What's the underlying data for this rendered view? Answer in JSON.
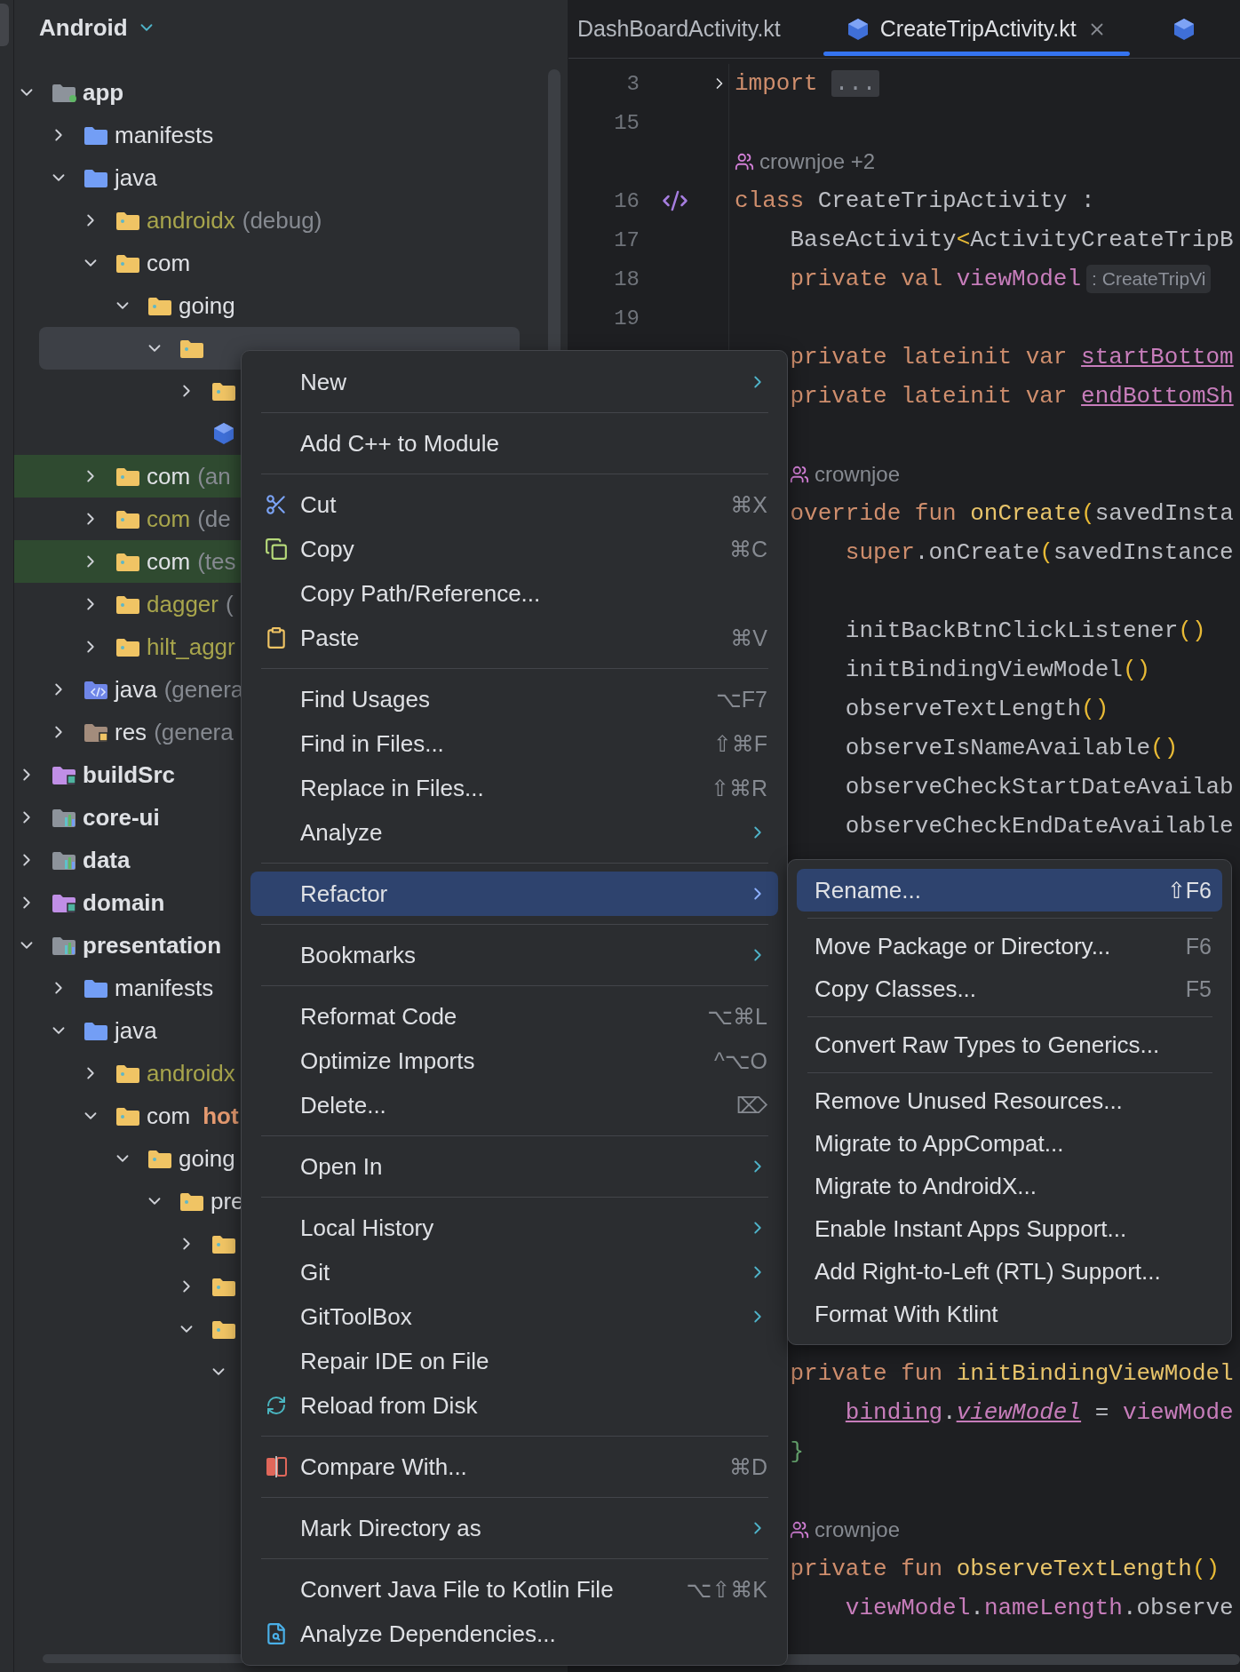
{
  "project": {
    "view": "Android",
    "tree": [
      {
        "label": "app",
        "kind": "module-app",
        "expanded": true,
        "selected": false,
        "highlighted": false,
        "children": [
          {
            "label": "manifests",
            "kind": "source-root",
            "expanded": false,
            "selected": false,
            "highlighted": false
          },
          {
            "label": "java",
            "kind": "source-root",
            "expanded": true,
            "selected": false,
            "highlighted": false,
            "children": [
              {
                "label": "androidx",
                "note": "(debug)",
                "color": "#a8a54c",
                "kind": "package",
                "expanded": false,
                "selected": false,
                "highlighted": false
              },
              {
                "label": "com",
                "kind": "package",
                "expanded": true,
                "selected": false,
                "highlighted": false,
                "children": [
                  {
                    "label": "going",
                    "kind": "package",
                    "expanded": true,
                    "selected": false,
                    "highlighted": false,
                    "children": [
                      {
                        "kind": "package",
                        "expanded": true,
                        "selected": true,
                        "highlighted": false,
                        "children": [
                          {
                            "kind": "package",
                            "expanded": false,
                            "selected": false,
                            "highlighted": false
                          },
                          {
                            "kind": "kotlin",
                            "selected": false,
                            "highlighted": false
                          }
                        ]
                      }
                    ]
                  }
                ]
              },
              {
                "label": "com",
                "note": "(an",
                "kind": "package",
                "expanded": false,
                "selected": false,
                "highlighted": true
              },
              {
                "label": "com",
                "note": "(de",
                "color": "#a8a54c",
                "kind": "package",
                "expanded": false,
                "selected": false,
                "highlighted": false
              },
              {
                "label": "com",
                "note": "(tes",
                "kind": "package",
                "expanded": false,
                "selected": false,
                "highlighted": true
              },
              {
                "label": "dagger",
                "note": "(",
                "color": "#a8a54c",
                "kind": "package",
                "expanded": false,
                "selected": false,
                "highlighted": false
              },
              {
                "label": "hilt_aggr",
                "color": "#a8a54c",
                "kind": "package",
                "expanded": false,
                "selected": false,
                "highlighted": false
              }
            ]
          },
          {
            "label": "java",
            "note": "(genera",
            "kind": "gen-source",
            "expanded": false,
            "selected": false,
            "highlighted": false
          },
          {
            "label": "res",
            "note": "(genera",
            "kind": "res",
            "expanded": false,
            "selected": false,
            "highlighted": false
          }
        ]
      },
      {
        "label": "buildSrc",
        "kind": "module-purple",
        "expanded": false,
        "selected": false,
        "highlighted": false
      },
      {
        "label": "core-ui",
        "kind": "module-lib",
        "expanded": false,
        "selected": false,
        "highlighted": false
      },
      {
        "label": "data",
        "kind": "module-lib",
        "expanded": false,
        "selected": false,
        "highlighted": false
      },
      {
        "label": "domain",
        "kind": "module-purple",
        "expanded": false,
        "selected": false,
        "highlighted": false
      },
      {
        "label": "presentation",
        "kind": "module-lib",
        "expanded": true,
        "selected": false,
        "highlighted": false,
        "children": [
          {
            "label": "manifests",
            "kind": "source-root",
            "expanded": false,
            "selected": false,
            "highlighted": false
          },
          {
            "label": "java",
            "kind": "source-root",
            "expanded": true,
            "selected": false,
            "highlighted": false,
            "children": [
              {
                "label": "androidx",
                "color": "#a8a54c",
                "kind": "package",
                "expanded": false,
                "selected": false,
                "highlighted": false
              },
              {
                "label": "com",
                "tag": "hot",
                "kind": "package",
                "expanded": true,
                "selected": false,
                "highlighted": false,
                "children": [
                  {
                    "label": "going",
                    "kind": "package",
                    "expanded": true,
                    "selected": false,
                    "highlighted": false,
                    "children": [
                      {
                        "label": "pre",
                        "kind": "package",
                        "expanded": true,
                        "selected": false,
                        "highlighted": false,
                        "children": [
                          {
                            "kind": "package",
                            "expanded": false,
                            "selected": false,
                            "highlighted": false
                          },
                          {
                            "kind": "package",
                            "expanded": false,
                            "selected": false,
                            "highlighted": false
                          },
                          {
                            "kind": "package",
                            "expanded": true,
                            "selected": false,
                            "highlighted": false,
                            "children": [
                              {
                                "expanded": true,
                                "selected": false,
                                "highlighted": false
                              }
                            ]
                          }
                        ]
                      }
                    ]
                  }
                ]
              }
            ]
          }
        ]
      }
    ]
  },
  "editor": {
    "tabs": [
      {
        "label": "DashBoardActivity.kt",
        "kind": "plain",
        "selected": false,
        "closable": false
      },
      {
        "label": "CreateTripActivity.kt",
        "kind": "kotlin",
        "selected": true,
        "closable": true
      },
      {
        "kind": "kotlin",
        "selected": false,
        "closable": false
      }
    ],
    "lines_top": [
      {
        "kind": "code-fold",
        "num": "3",
        "tokens": [
          {
            "t": "import",
            "kind": "kw"
          }
        ],
        "fold": "..."
      },
      {
        "kind": "code",
        "num": "15"
      },
      {
        "kind": "author",
        "text": "crownjoe +2"
      },
      {
        "kind": "code-class",
        "num": "16",
        "tokens": [
          {
            "t": "class ",
            "kind": "kw"
          },
          {
            "t": "CreateTripActivity :",
            "kind": "plain"
          }
        ]
      },
      {
        "kind": "code",
        "num": "17",
        "tokens": [
          {
            "t": "    BaseActivity",
            "kind": "plain"
          },
          {
            "t": "<",
            "kind": "paren"
          },
          {
            "t": "ActivityCreateTripB",
            "kind": "plain"
          }
        ]
      },
      {
        "kind": "code",
        "num": "18",
        "tokens": [
          {
            "t": "    private val ",
            "kind": "kw"
          },
          {
            "t": "viewModel",
            "kind": "prop"
          }
        ],
        "hint": ": CreateTripVi"
      },
      {
        "kind": "code",
        "num": "19"
      },
      {
        "kind": "code",
        "tokens": [
          {
            "t": "    private lateinit var ",
            "kind": "kw"
          },
          {
            "t": "startBottom",
            "kind": "prop-u"
          }
        ]
      },
      {
        "kind": "code",
        "tokens": [
          {
            "t": "    private lateinit var ",
            "kind": "kw"
          },
          {
            "t": "endBottomSh",
            "kind": "prop-u"
          }
        ]
      },
      {
        "kind": "code"
      },
      {
        "kind": "author-indented",
        "text": "crownjoe"
      },
      {
        "kind": "code",
        "tokens": [
          {
            "t": "    override fun ",
            "kind": "kw"
          },
          {
            "t": "onCreate",
            "kind": "fn"
          },
          {
            "t": "(",
            "kind": "paren"
          },
          {
            "t": "savedInsta",
            "kind": "plain"
          }
        ]
      },
      {
        "kind": "code",
        "tokens": [
          {
            "t": "        super",
            "kind": "kw"
          },
          {
            "t": ".onCreate",
            "kind": "plain"
          },
          {
            "t": "(",
            "kind": "paren"
          },
          {
            "t": "savedInstance",
            "kind": "plain"
          }
        ]
      },
      {
        "kind": "code"
      },
      {
        "kind": "code",
        "tokens": [
          {
            "t": "        initBackBtnClickListener",
            "kind": "plain"
          },
          {
            "t": "()",
            "kind": "paren"
          }
        ]
      },
      {
        "kind": "code",
        "tokens": [
          {
            "t": "        initBindingViewModel",
            "kind": "plain"
          },
          {
            "t": "()",
            "kind": "paren"
          }
        ]
      },
      {
        "kind": "code",
        "tokens": [
          {
            "t": "        observeTextLength",
            "kind": "plain"
          },
          {
            "t": "()",
            "kind": "paren"
          }
        ]
      },
      {
        "kind": "code",
        "tokens": [
          {
            "t": "        observeIsNameAvailable",
            "kind": "plain"
          },
          {
            "t": "()",
            "kind": "paren"
          }
        ]
      },
      {
        "kind": "code",
        "tokens": [
          {
            "t": "        observeCheckStartDateAvailab",
            "kind": "plain"
          }
        ]
      },
      {
        "kind": "code",
        "tokens": [
          {
            "t": "        observeCheckEndDateAvailable",
            "kind": "plain"
          }
        ]
      }
    ],
    "lines_bottom": [
      {
        "kind": "code",
        "tokens": [
          {
            "t": "    private fun ",
            "kind": "kw"
          },
          {
            "t": "initBindingViewModel",
            "kind": "fn"
          }
        ]
      },
      {
        "kind": "code",
        "tokens": [
          {
            "t": "        binding",
            "kind": "prop-u"
          },
          {
            "t": ".",
            "kind": "plain"
          },
          {
            "t": "viewModel",
            "kind": "prop-iu"
          },
          {
            "t": " = ",
            "kind": "plain"
          },
          {
            "t": "viewMode",
            "kind": "prop"
          }
        ]
      },
      {
        "kind": "code",
        "tokens": [
          {
            "t": "    }",
            "kind": "brace"
          }
        ]
      },
      {
        "kind": "code"
      },
      {
        "kind": "author-indented",
        "text": "crownjoe"
      },
      {
        "kind": "code",
        "tokens": [
          {
            "t": "    private fun ",
            "kind": "kw"
          },
          {
            "t": "observeTextLength",
            "kind": "fn"
          },
          {
            "t": "()",
            "kind": "paren"
          }
        ]
      },
      {
        "kind": "code",
        "tokens": [
          {
            "t": "        viewModel",
            "kind": "prop"
          },
          {
            "t": ".",
            "kind": "plain"
          },
          {
            "t": "nameLength",
            "kind": "prop"
          },
          {
            "t": ".observe",
            "kind": "plain"
          }
        ]
      }
    ]
  },
  "context_menu": {
    "items": [
      {
        "kind": "item",
        "label": "New",
        "submenu": true,
        "selected": false
      },
      {
        "kind": "separator"
      },
      {
        "kind": "item",
        "label": "Add C++ to Module",
        "submenu": false,
        "selected": false
      },
      {
        "kind": "separator"
      },
      {
        "kind": "cut",
        "label": "Cut",
        "shortcut": "⌘X",
        "submenu": false,
        "selected": false
      },
      {
        "kind": "copy",
        "label": "Copy",
        "shortcut": "⌘C",
        "submenu": false,
        "selected": false
      },
      {
        "kind": "item",
        "label": "Copy Path/Reference...",
        "submenu": false,
        "selected": false
      },
      {
        "kind": "paste",
        "label": "Paste",
        "shortcut": "⌘V",
        "submenu": false,
        "selected": false
      },
      {
        "kind": "separator"
      },
      {
        "kind": "item",
        "label": "Find Usages",
        "shortcut": "⌥F7",
        "submenu": false,
        "selected": false
      },
      {
        "kind": "item",
        "label": "Find in Files...",
        "shortcut": "⇧⌘F",
        "submenu": false,
        "selected": false
      },
      {
        "kind": "item",
        "label": "Replace in Files...",
        "shortcut": "⇧⌘R",
        "submenu": false,
        "selected": false
      },
      {
        "kind": "item",
        "label": "Analyze",
        "submenu": true,
        "selected": false
      },
      {
        "kind": "separator"
      },
      {
        "kind": "item",
        "label": "Refactor",
        "submenu": true,
        "selected": true
      },
      {
        "kind": "separator"
      },
      {
        "kind": "item",
        "label": "Bookmarks",
        "submenu": true,
        "selected": false
      },
      {
        "kind": "separator"
      },
      {
        "kind": "item",
        "label": "Reformat Code",
        "shortcut": "⌥⌘L",
        "submenu": false,
        "selected": false
      },
      {
        "kind": "item",
        "label": "Optimize Imports",
        "shortcut": "^⌥O",
        "submenu": false,
        "selected": false
      },
      {
        "kind": "item",
        "label": "Delete...",
        "shortcut": "⌦",
        "submenu": false,
        "selected": false
      },
      {
        "kind": "separator"
      },
      {
        "kind": "item",
        "label": "Open In",
        "submenu": true,
        "selected": false
      },
      {
        "kind": "separator"
      },
      {
        "kind": "item",
        "label": "Local History",
        "submenu": true,
        "selected": false
      },
      {
        "kind": "item",
        "label": "Git",
        "submenu": true,
        "selected": false
      },
      {
        "kind": "item",
        "label": "GitToolBox",
        "submenu": true,
        "selected": false
      },
      {
        "kind": "item",
        "label": "Repair IDE on File",
        "submenu": false,
        "selected": false
      },
      {
        "kind": "reload",
        "label": "Reload from Disk",
        "submenu": false,
        "selected": false
      },
      {
        "kind": "separator"
      },
      {
        "kind": "compare",
        "label": "Compare With...",
        "shortcut": "⌘D",
        "submenu": false,
        "selected": false
      },
      {
        "kind": "separator"
      },
      {
        "kind": "item",
        "label": "Mark Directory as",
        "submenu": true,
        "selected": false
      },
      {
        "kind": "separator"
      },
      {
        "kind": "item",
        "label": "Convert Java File to Kotlin File",
        "shortcut": "⌥⇧⌘K",
        "submenu": false,
        "selected": false
      },
      {
        "kind": "dependencies",
        "label": "Analyze Dependencies...",
        "submenu": false,
        "selected": false
      }
    ]
  },
  "submenu": {
    "items": [
      {
        "kind": "item",
        "label": "Rename...",
        "shortcut": "⇧F6",
        "selected": true
      },
      {
        "kind": "separator"
      },
      {
        "kind": "item",
        "label": "Move Package or Directory...",
        "shortcut": "F6",
        "selected": false
      },
      {
        "kind": "item",
        "label": "Copy Classes...",
        "shortcut": "F5",
        "selected": false
      },
      {
        "kind": "separator"
      },
      {
        "kind": "item",
        "label": "Convert Raw Types to Generics...",
        "selected": false
      },
      {
        "kind": "separator"
      },
      {
        "kind": "item",
        "label": "Remove Unused Resources...",
        "selected": false
      },
      {
        "kind": "item",
        "label": "Migrate to AppCompat...",
        "selected": false
      },
      {
        "kind": "item",
        "label": "Migrate to AndroidX...",
        "selected": false
      },
      {
        "kind": "item",
        "label": "Enable Instant Apps Support...",
        "selected": false
      },
      {
        "kind": "item",
        "label": "Add Right-to-Left (RTL) Support...",
        "selected": false
      },
      {
        "kind": "item",
        "label": "Format With Ktlint",
        "selected": false
      }
    ]
  }
}
